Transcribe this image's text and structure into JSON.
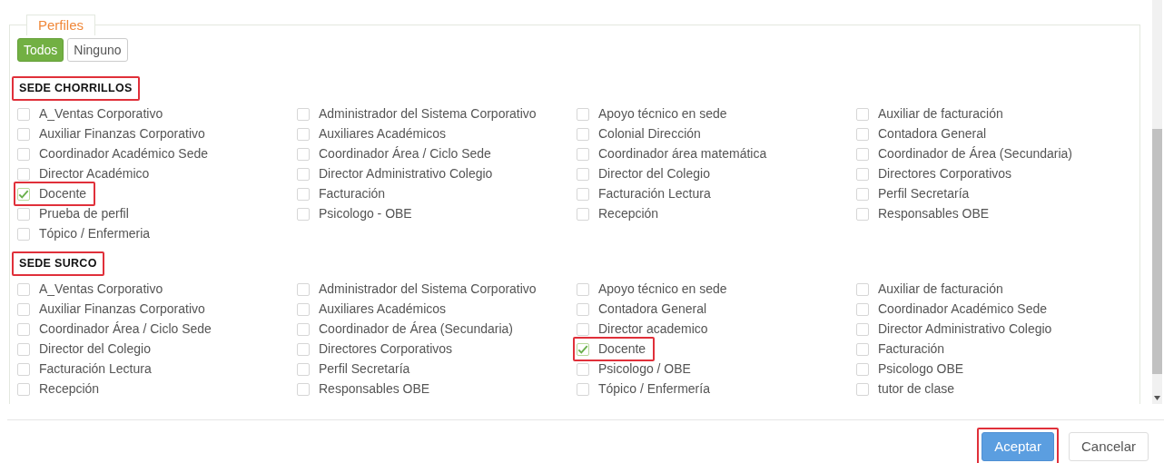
{
  "legend": "Perfiles",
  "filter_buttons": [
    {
      "label": "Todos",
      "selected": true
    },
    {
      "label": "Ninguno",
      "selected": false
    }
  ],
  "sections": [
    {
      "title": "SEDE CHORRILLOS",
      "highlighted": true,
      "profiles": [
        {
          "label": "A_Ventas Corporativo",
          "checked": false,
          "highlighted": false
        },
        {
          "label": "Administrador del Sistema Corporativo",
          "checked": false,
          "highlighted": false
        },
        {
          "label": "Apoyo técnico en sede",
          "checked": false,
          "highlighted": false
        },
        {
          "label": "Auxiliar de facturación",
          "checked": false,
          "highlighted": false
        },
        {
          "label": "Auxiliar Finanzas Corporativo",
          "checked": false,
          "highlighted": false
        },
        {
          "label": "Auxiliares Académicos",
          "checked": false,
          "highlighted": false
        },
        {
          "label": "Colonial Dirección",
          "checked": false,
          "highlighted": false
        },
        {
          "label": "Contadora General",
          "checked": false,
          "highlighted": false
        },
        {
          "label": "Coordinador Académico Sede",
          "checked": false,
          "highlighted": false
        },
        {
          "label": "Coordinador Área / Ciclo Sede",
          "checked": false,
          "highlighted": false
        },
        {
          "label": "Coordinador área matemática",
          "checked": false,
          "highlighted": false
        },
        {
          "label": "Coordinador de Área (Secundaria)",
          "checked": false,
          "highlighted": false
        },
        {
          "label": "Director Académico",
          "checked": false,
          "highlighted": false
        },
        {
          "label": "Director Administrativo Colegio",
          "checked": false,
          "highlighted": false
        },
        {
          "label": "Director del Colegio",
          "checked": false,
          "highlighted": false
        },
        {
          "label": "Directores Corporativos",
          "checked": false,
          "highlighted": false
        },
        {
          "label": "Docente",
          "checked": true,
          "highlighted": true
        },
        {
          "label": "Facturación",
          "checked": false,
          "highlighted": false
        },
        {
          "label": "Facturación Lectura",
          "checked": false,
          "highlighted": false
        },
        {
          "label": "Perfil Secretaría",
          "checked": false,
          "highlighted": false
        },
        {
          "label": "Prueba de perfil",
          "checked": false,
          "highlighted": false
        },
        {
          "label": "Psicologo - OBE",
          "checked": false,
          "highlighted": false
        },
        {
          "label": "Recepción",
          "checked": false,
          "highlighted": false
        },
        {
          "label": "Responsables OBE",
          "checked": false,
          "highlighted": false
        },
        {
          "label": "Tópico / Enfermeria",
          "checked": false,
          "highlighted": false
        }
      ]
    },
    {
      "title": "SEDE SURCO",
      "highlighted": true,
      "profiles": [
        {
          "label": "A_Ventas Corporativo",
          "checked": false,
          "highlighted": false
        },
        {
          "label": "Administrador del Sistema Corporativo",
          "checked": false,
          "highlighted": false
        },
        {
          "label": "Apoyo técnico en sede",
          "checked": false,
          "highlighted": false
        },
        {
          "label": "Auxiliar de facturación",
          "checked": false,
          "highlighted": false
        },
        {
          "label": "Auxiliar Finanzas Corporativo",
          "checked": false,
          "highlighted": false
        },
        {
          "label": "Auxiliares Académicos",
          "checked": false,
          "highlighted": false
        },
        {
          "label": "Contadora General",
          "checked": false,
          "highlighted": false
        },
        {
          "label": "Coordinador Académico Sede",
          "checked": false,
          "highlighted": false
        },
        {
          "label": "Coordinador Área / Ciclo Sede",
          "checked": false,
          "highlighted": false
        },
        {
          "label": "Coordinador de Área (Secundaria)",
          "checked": false,
          "highlighted": false
        },
        {
          "label": "Director academico",
          "checked": false,
          "highlighted": false
        },
        {
          "label": "Director Administrativo Colegio",
          "checked": false,
          "highlighted": false
        },
        {
          "label": "Director del Colegio",
          "checked": false,
          "highlighted": false
        },
        {
          "label": "Directores Corporativos",
          "checked": false,
          "highlighted": false
        },
        {
          "label": "Docente",
          "checked": true,
          "highlighted": true
        },
        {
          "label": "Facturación",
          "checked": false,
          "highlighted": false
        },
        {
          "label": "Facturación Lectura",
          "checked": false,
          "highlighted": false
        },
        {
          "label": "Perfil Secretaría",
          "checked": false,
          "highlighted": false
        },
        {
          "label": "Psicologo / OBE",
          "checked": false,
          "highlighted": false
        },
        {
          "label": "Psicologo OBE",
          "checked": false,
          "highlighted": false
        },
        {
          "label": "Recepción",
          "checked": false,
          "highlighted": false
        },
        {
          "label": "Responsables OBE",
          "checked": false,
          "highlighted": false
        },
        {
          "label": "Tópico / Enfermería",
          "checked": false,
          "highlighted": false
        },
        {
          "label": "tutor de clase",
          "checked": false,
          "highlighted": false
        }
      ]
    }
  ],
  "footer_buttons": [
    {
      "label": "Aceptar",
      "kind": "primary",
      "highlighted": true
    },
    {
      "label": "Cancelar",
      "kind": "secondary",
      "highlighted": false
    }
  ]
}
